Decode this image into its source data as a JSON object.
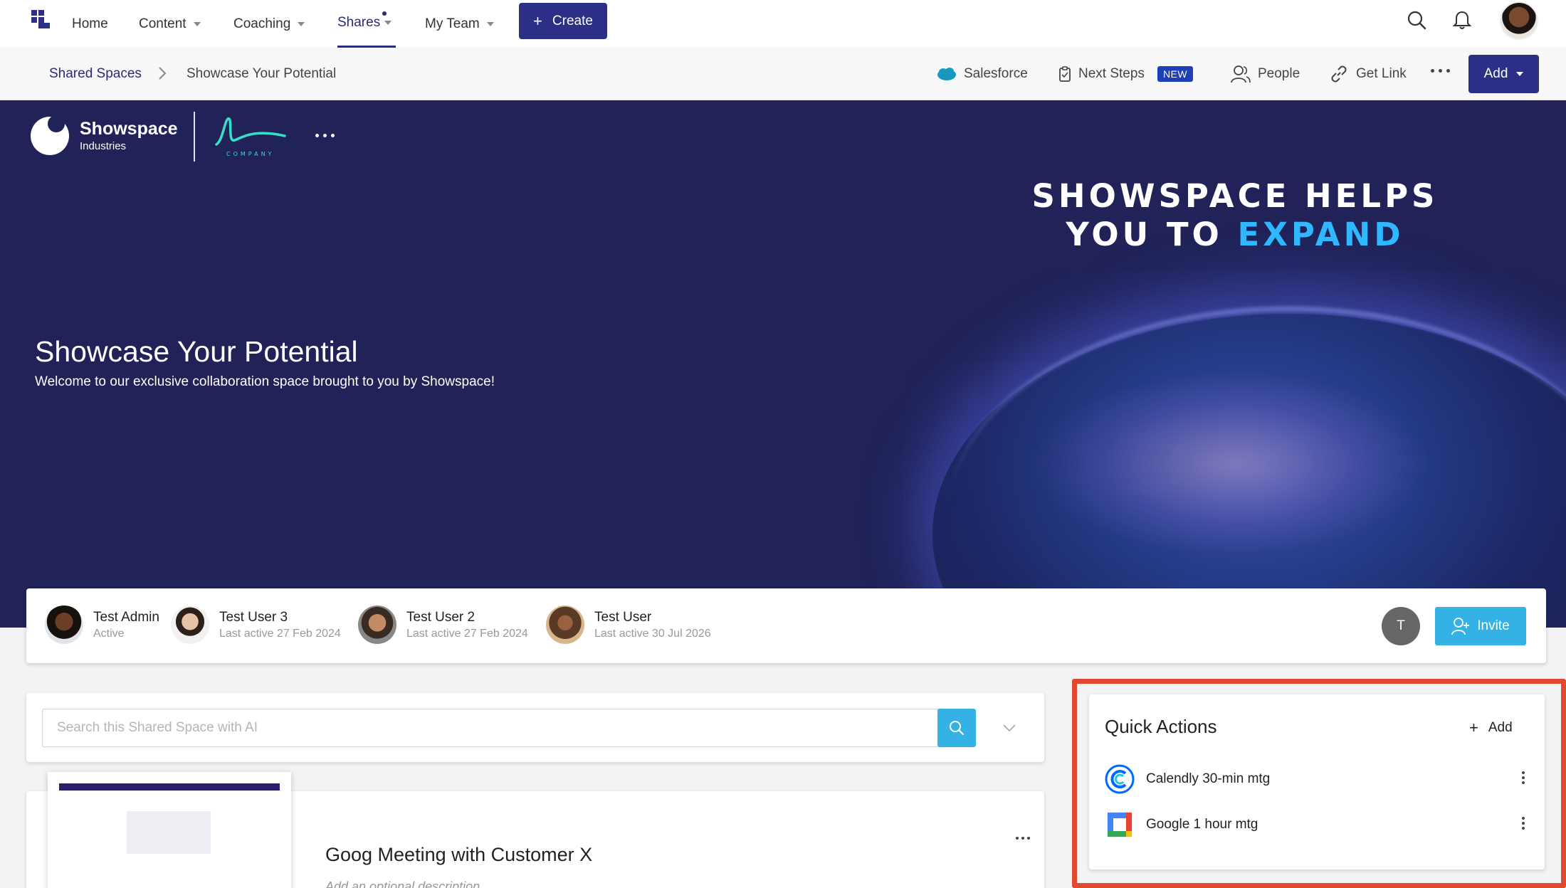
{
  "nav": {
    "items": [
      {
        "label": "Home"
      },
      {
        "label": "Content"
      },
      {
        "label": "Coaching"
      },
      {
        "label": "Shares"
      },
      {
        "label": "My Team"
      }
    ],
    "create_label": "Create"
  },
  "breadcrumb": {
    "parent": "Shared Spaces",
    "current": "Showcase Your Potential"
  },
  "toolbar": {
    "salesforce": "Salesforce",
    "next_steps": "Next Steps",
    "new_badge": "NEW",
    "people": "People",
    "get_link": "Get Link",
    "add": "Add"
  },
  "hero": {
    "brand_name": "Showspace",
    "brand_sub": "Industries",
    "company_logo_text": "COMPANY",
    "headline_line1": "SHOWSPACE HELPS",
    "headline_line2_a": "YOU TO ",
    "headline_line2_b": "EXPAND",
    "title": "Showcase Your Potential",
    "subtitle": "Welcome to our exclusive collaboration space brought to you by Showspace!"
  },
  "members": [
    {
      "name": "Test Admin",
      "status": "Active"
    },
    {
      "name": "Test User 3",
      "status": "Last active 27 Feb 2024"
    },
    {
      "name": "Test User 2",
      "status": "Last active 27 Feb 2024"
    },
    {
      "name": "Test User",
      "status": "Last active 30 Jul 2026"
    }
  ],
  "extra_member_initial": "T",
  "invite_label": "Invite",
  "search": {
    "placeholder": "Search this Shared Space with AI"
  },
  "content_card": {
    "title": "Goog Meeting with Customer X",
    "description": "Add an optional description"
  },
  "quick_actions": {
    "title": "Quick Actions",
    "add_label": "Add",
    "items": [
      {
        "label": "Calendly 30-min mtg",
        "icon": "calendly-icon"
      },
      {
        "label": "Google 1 hour mtg",
        "icon": "google-calendar-icon"
      }
    ]
  },
  "colors": {
    "primary": "#2c2f85",
    "hero_bg": "#202258",
    "accent": "#34b1e5",
    "highlight": "#e04a2f",
    "expand_text": "#2fb7ff"
  }
}
